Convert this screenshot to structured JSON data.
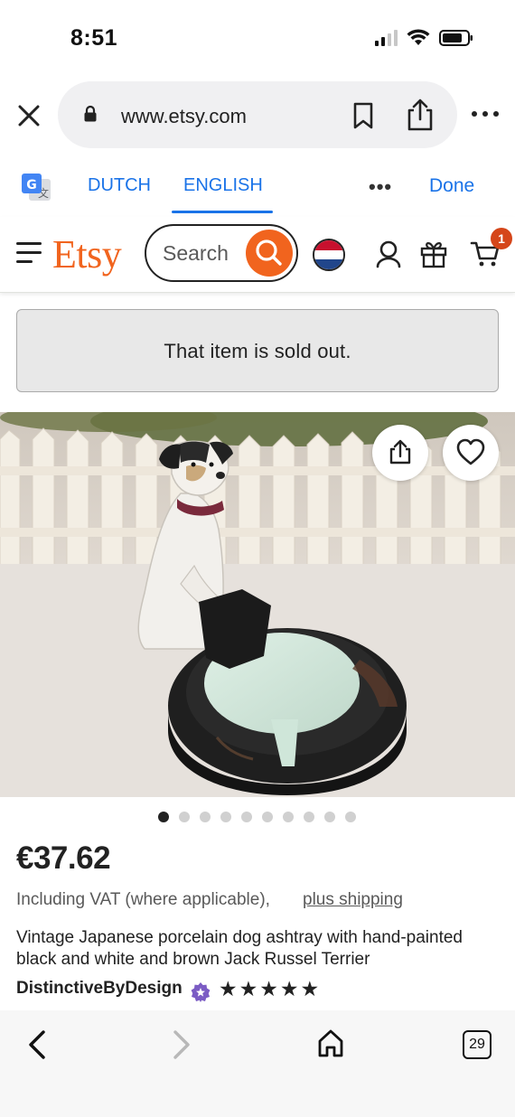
{
  "status_bar": {
    "time": "8:51"
  },
  "browser": {
    "url": "www.etsy.com",
    "tab_count": "29"
  },
  "translate_bar": {
    "source_lang": "DUTCH",
    "target_lang": "ENGLISH",
    "active_lang": "ENGLISH",
    "more": "•••",
    "done": "Done"
  },
  "header": {
    "logo": "Etsy",
    "search_placeholder": "Search",
    "cart_count": "1",
    "region_flag": "netherlands-flag"
  },
  "alert": {
    "message": "That item is sold out."
  },
  "gallery": {
    "image_description": "porcelain dog ashtray",
    "total_images": 10,
    "active_index": 0
  },
  "product": {
    "price": "€37.62",
    "vat_text": "Including VAT (where applicable),",
    "shipping_link": "plus shipping",
    "title": "Vintage Japanese porcelain dog ashtray with hand-painted black and white and brown Jack Russel Terrier",
    "shop_name": "DistinctiveByDesign",
    "rating_stars": "★★★★★",
    "rating_value": 5
  },
  "colors": {
    "etsy_orange": "#f1641e",
    "link_blue": "#1a73e8",
    "badge_red": "#d5461a"
  }
}
